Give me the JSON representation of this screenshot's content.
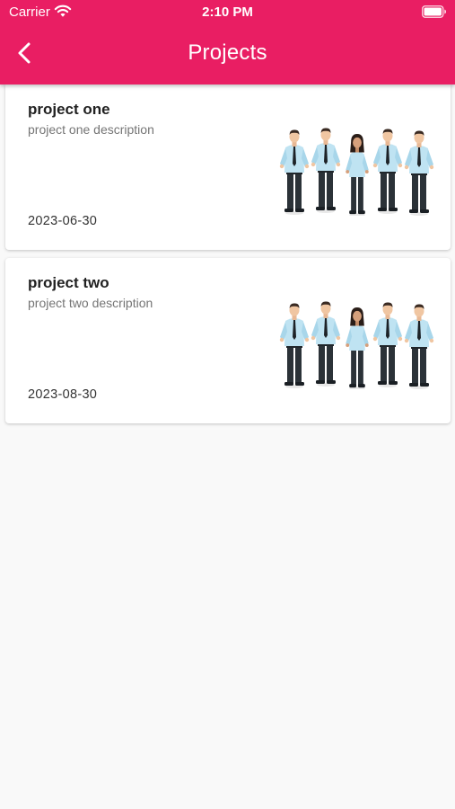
{
  "status_bar": {
    "carrier": "Carrier",
    "time": "2:10 PM"
  },
  "header": {
    "title": "Projects",
    "back_icon": "chevron-left-icon",
    "color": "#e91e63"
  },
  "projects": [
    {
      "name": "project one",
      "description": "project one description",
      "date": "2023-06-30",
      "image": "team-illustration"
    },
    {
      "name": "project two",
      "description": "project two description",
      "date": "2023-08-30",
      "image": "team-illustration"
    }
  ]
}
